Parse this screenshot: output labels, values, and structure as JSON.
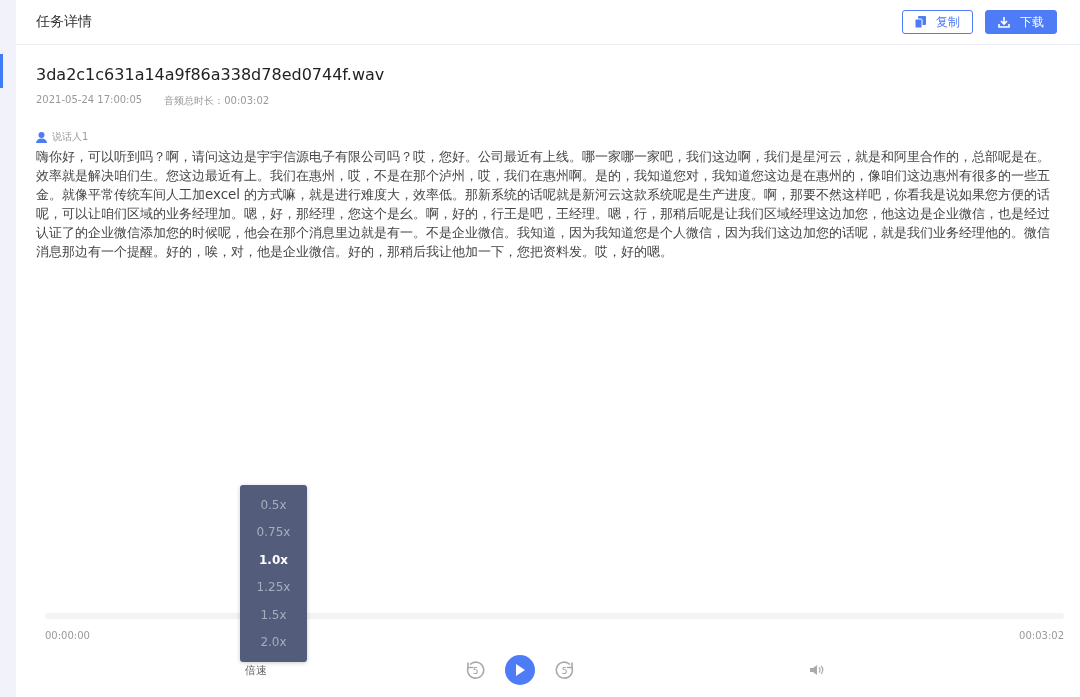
{
  "header": {
    "title": "任务详情",
    "buttons": [
      {
        "kind": "copy",
        "label": "复制"
      },
      {
        "kind": "download",
        "label": "下载"
      }
    ]
  },
  "file": {
    "name": "3da2c1c631a14a9f86a338d78ed0744f.wav",
    "date": "2021-05-24 17:00:05",
    "duration_label": "音频总时长：00:03:02"
  },
  "transcript": {
    "speaker": "说话人1",
    "text": "嗨你好，可以听到吗？啊，请问这边是宇宇信源电子有限公司吗？哎，您好。公司最近有上线。哪一家哪一家吧，我们这边啊，我们是星河云，就是和阿里合作的，总部呢是在。效率就是解决咱们生。您这边最近有上。我们在惠州，哎，不是在那个泸州，哎，我们在惠州啊。是的，我知道您对，我知道您这边是在惠州的，像咱们这边惠州有很多的一些五金。就像平常传统车间人工加excel 的方式嘛，就是进行难度大，效率低。那新系统的话呢就是新河云这款系统呢是生产进度。啊，那要不然这样吧，你看我是说如果您方便的话呢，可以让咱们区域的业务经理加。嗯，好，那经理，您这个是幺。啊，好的，行王是吧，王经理。嗯，行，那稍后呢是让我们区域经理这边加您，他这边是企业微信，也是经过认证了的企业微信添加您的时候呢，他会在那个消息里边就是有一。不是企业微信。我知道，因为我知道您是个人微信，因为我们这边加您的话呢，就是我们业务经理他的。微信消息那边有一个提醒。好的，唉，对，他是企业微信。好的，那稍后我让他加一下，您把资料发。哎，好的嗯。"
  },
  "player": {
    "level": 0,
    "current_time": "00:00:00",
    "total_time": "00:03:02",
    "speed_label": "倍速",
    "rewind_label": "5",
    "forward_label": "5",
    "playing": false,
    "speed_options": [
      {
        "label": "0.5x",
        "selected": false
      },
      {
        "label": "0.75x",
        "selected": false
      },
      {
        "label": "1.0x",
        "selected": true
      },
      {
        "label": "1.25x",
        "selected": false
      },
      {
        "label": "1.5x",
        "selected": false
      },
      {
        "label": "2.0x",
        "selected": false
      }
    ]
  }
}
